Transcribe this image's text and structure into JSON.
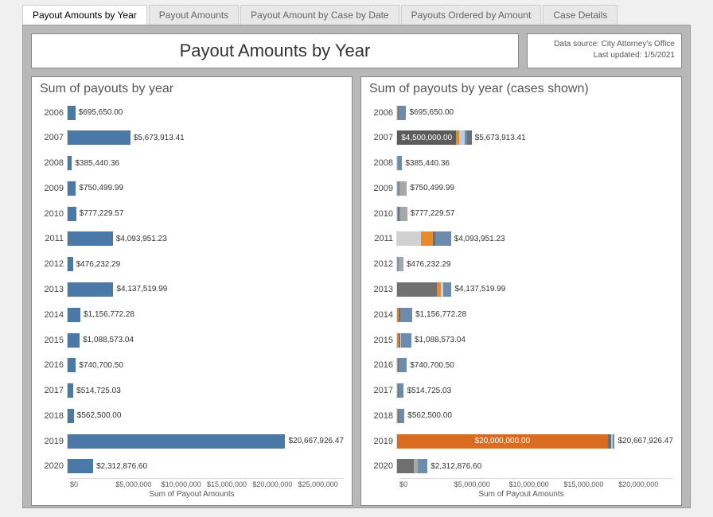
{
  "tabs": [
    {
      "label": "Payout Amounts by Year",
      "active": true
    },
    {
      "label": "Payout Amounts",
      "active": false
    },
    {
      "label": "Payout Amount by Case by Date",
      "active": false
    },
    {
      "label": "Payouts Ordered by Amount",
      "active": false
    },
    {
      "label": "Case Details",
      "active": false
    }
  ],
  "title": "Payout Amounts by Year",
  "info": {
    "line1": "Data source: City Attorney's Office",
    "line2": "Last updated: 1/5/2021"
  },
  "chart_data": [
    {
      "type": "bar",
      "title": "Sum of payouts by year",
      "xlabel": "Sum of Payout Amounts",
      "categories": [
        "2006",
        "2007",
        "2008",
        "2009",
        "2010",
        "2011",
        "2012",
        "2013",
        "2014",
        "2015",
        "2016",
        "2017",
        "2018",
        "2019",
        "2020"
      ],
      "values": [
        695650.0,
        5673913.41,
        385440.36,
        750499.99,
        777229.57,
        4093951.23,
        476232.29,
        4137519.99,
        1156772.28,
        1088573.04,
        740700.5,
        514725.03,
        562500.0,
        20667926.47,
        2312876.6
      ],
      "value_labels": [
        "$695,650.00",
        "$5,673,913.41",
        "$385,440.36",
        "$750,499.99",
        "$777,229.57",
        "$4,093,951.23",
        "$476,232.29",
        "$4,137,519.99",
        "$1,156,772.28",
        "$1,088,573.04",
        "$740,700.50",
        "$514,725.03",
        "$562,500.00",
        "$20,667,926.47",
        "$2,312,876.60"
      ],
      "xticks": [
        "$0",
        "$5,000,000",
        "$10,000,000",
        "$15,000,000",
        "$20,000,000",
        "$25,000,000"
      ],
      "xlim": [
        0,
        25000000
      ],
      "color": "#4a79a8"
    },
    {
      "type": "bar",
      "subtype": "stacked",
      "title": "Sum of payouts by year (cases shown)",
      "xlabel": "Sum of Payout Amounts",
      "categories": [
        "2006",
        "2007",
        "2008",
        "2009",
        "2010",
        "2011",
        "2012",
        "2013",
        "2014",
        "2015",
        "2016",
        "2017",
        "2018",
        "2019",
        "2020"
      ],
      "totals": [
        695650.0,
        5673913.41,
        385440.36,
        750499.99,
        777229.57,
        4093951.23,
        476232.29,
        4137519.99,
        1156772.28,
        1088573.04,
        740700.5,
        514725.03,
        562500.0,
        20667926.47,
        2312876.6
      ],
      "total_labels": [
        "$695,650.00",
        "$5,673,913.41",
        "$385,440.36",
        "$750,499.99",
        "$777,229.57",
        "$4,093,951.23",
        "$476,232.29",
        "$4,137,519.99",
        "$1,156,772.28",
        "$1,088,573.04",
        "$740,700.50",
        "$514,725.03",
        "$562,500.00",
        "$20,667,926.47",
        "$2,312,876.60"
      ],
      "segments": [
        [
          {
            "v": 60000,
            "c": "#e88a2a"
          },
          {
            "v": 80000,
            "c": "#6f6f6f"
          },
          {
            "v": 555650,
            "c": "#6d8bad"
          }
        ],
        [
          {
            "v": 4500000,
            "c": "#5b5b5b",
            "label": "$4,500,000.00"
          },
          {
            "v": 200000,
            "c": "#e88a2a"
          },
          {
            "v": 450000,
            "c": "#b9cde0"
          },
          {
            "v": 180000,
            "c": "#6d8bad"
          },
          {
            "v": 343913.41,
            "c": "#6f6f6f"
          }
        ],
        [
          {
            "v": 40000,
            "c": "#e88a2a"
          },
          {
            "v": 50000,
            "c": "#a7a7a7"
          },
          {
            "v": 295440.36,
            "c": "#6d8bad"
          }
        ],
        [
          {
            "v": 70000,
            "c": "#e88a2a"
          },
          {
            "v": 100000,
            "c": "#6d8bad"
          },
          {
            "v": 580499.99,
            "c": "#a7a7a7"
          }
        ],
        [
          {
            "v": 80000,
            "c": "#e88a2a"
          },
          {
            "v": 60000,
            "c": "#6f6f6f"
          },
          {
            "v": 90000,
            "c": "#6d8bad"
          },
          {
            "v": 547229.57,
            "c": "#a7a7a7"
          }
        ],
        [
          {
            "v": 1800000,
            "c": "#d0d0d0"
          },
          {
            "v": 900000,
            "c": "#e88a2a"
          },
          {
            "v": 200000,
            "c": "#6f6f6f"
          },
          {
            "v": 1193951.23,
            "c": "#6d8bad"
          }
        ],
        [
          {
            "v": 40000,
            "c": "#e88a2a"
          },
          {
            "v": 70000,
            "c": "#6d8bad"
          },
          {
            "v": 366232.29,
            "c": "#a7a7a7"
          }
        ],
        [
          {
            "v": 3000000,
            "c": "#707070"
          },
          {
            "v": 300000,
            "c": "#e88a2a"
          },
          {
            "v": 200000,
            "c": "#d0d0d0"
          },
          {
            "v": 637519.99,
            "c": "#6d8bad"
          }
        ],
        [
          {
            "v": 150000,
            "c": "#e88a2a"
          },
          {
            "v": 100000,
            "c": "#6f6f6f"
          },
          {
            "v": 906772.28,
            "c": "#6d8bad"
          }
        ],
        [
          {
            "v": 100000,
            "c": "#e88a2a"
          },
          {
            "v": 120000,
            "c": "#6f6f6f"
          },
          {
            "v": 100000,
            "c": "#d0d0d0"
          },
          {
            "v": 768573.04,
            "c": "#6d8bad"
          }
        ],
        [
          {
            "v": 60000,
            "c": "#e88a2a"
          },
          {
            "v": 70000,
            "c": "#6f6f6f"
          },
          {
            "v": 610700.5,
            "c": "#6d8bad"
          }
        ],
        [
          {
            "v": 50000,
            "c": "#e88a2a"
          },
          {
            "v": 60000,
            "c": "#6f6f6f"
          },
          {
            "v": 404725.03,
            "c": "#6d8bad"
          }
        ],
        [
          {
            "v": 50000,
            "c": "#e88a2a"
          },
          {
            "v": 70000,
            "c": "#6f6f6f"
          },
          {
            "v": 442500.0,
            "c": "#6d8bad"
          }
        ],
        [
          {
            "v": 20000000,
            "c": "#d96c20",
            "label": "$20,000,000.00"
          },
          {
            "v": 300000,
            "c": "#6f6f6f"
          },
          {
            "v": 200000,
            "c": "#b9cde0"
          },
          {
            "v": 167926.47,
            "c": "#6d8bad"
          }
        ],
        [
          {
            "v": 1300000,
            "c": "#6f6f6f"
          },
          {
            "v": 300000,
            "c": "#a7a7a7"
          },
          {
            "v": 712876.6,
            "c": "#6d8bad"
          }
        ]
      ],
      "xticks": [
        "$0",
        "$5,000,000",
        "$10,000,000",
        "$15,000,000",
        "$20,000,000"
      ],
      "xlim": [
        0,
        21000000
      ]
    }
  ]
}
